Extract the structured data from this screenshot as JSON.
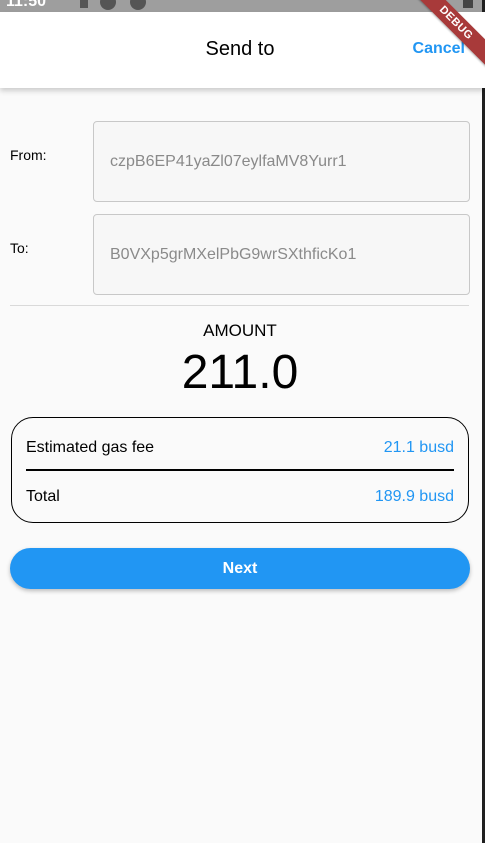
{
  "status_bar": {
    "time": "11:50"
  },
  "app_bar": {
    "title": "Send to",
    "cancel_label": "Cancel",
    "debug_label": "DEBUG"
  },
  "form": {
    "from_label": "From:",
    "from_value": "czpB6EP41yaZl07eylfaMV8Yurr1",
    "to_label": "To:",
    "to_value": "B0VXp5grMXelPbG9wrSXthficKo1"
  },
  "amount": {
    "label": "AMOUNT",
    "value": "211.0"
  },
  "fees": {
    "gas_label": "Estimated gas fee",
    "gas_value": "21.1 busd",
    "total_label": "Total",
    "total_value": "189.9 busd"
  },
  "actions": {
    "next_label": "Next"
  },
  "colors": {
    "accent": "#2196f3",
    "background": "#fafafa",
    "debug_ribbon": "#a83a3a"
  }
}
